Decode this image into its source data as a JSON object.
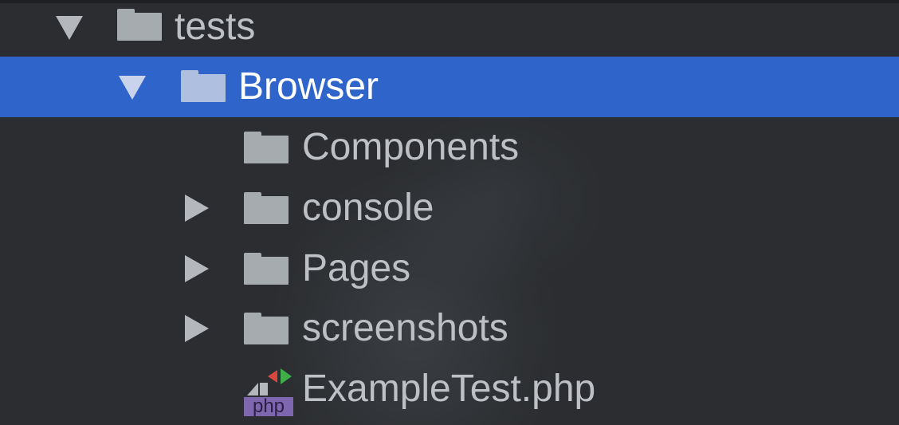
{
  "tree": {
    "items": [
      {
        "label": "tests",
        "expanded": true,
        "selected": false,
        "icon": "folder-icon",
        "arrow": "expanded"
      },
      {
        "label": "Browser",
        "expanded": true,
        "selected": true,
        "icon": "folder-icon",
        "arrow": "expanded"
      },
      {
        "label": "Components",
        "expanded": false,
        "selected": false,
        "icon": "folder-icon",
        "arrow": "none"
      },
      {
        "label": "console",
        "expanded": false,
        "selected": false,
        "icon": "folder-icon",
        "arrow": "collapsed"
      },
      {
        "label": "Pages",
        "expanded": false,
        "selected": false,
        "icon": "folder-icon",
        "arrow": "collapsed"
      },
      {
        "label": "screenshots",
        "expanded": false,
        "selected": false,
        "icon": "folder-icon",
        "arrow": "collapsed"
      },
      {
        "label": "ExampleTest.php",
        "expanded": false,
        "selected": false,
        "icon": "php-file-icon",
        "arrow": "none",
        "badge": "php"
      }
    ]
  },
  "colors": {
    "background": "#2b2d30",
    "selection": "#2f65ca",
    "text": "#bdc1c5",
    "selected_text": "#ffffff",
    "folder": "#a6abb0",
    "php_badge": "#7e67ae"
  }
}
